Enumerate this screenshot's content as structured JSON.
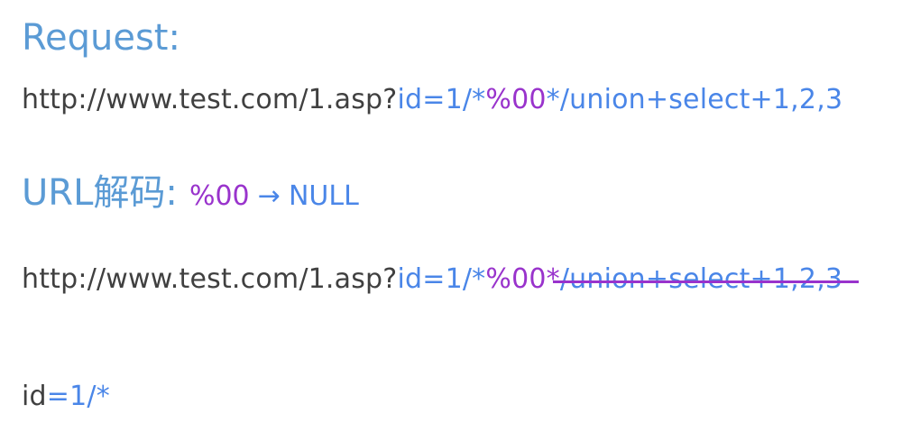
{
  "request": {
    "heading": "Request:",
    "url_base": "http://www.test.com/1.asp?",
    "param_name": "id",
    "equals": "=",
    "value_prefix": "1/*",
    "null_byte": "%00",
    "comment_close": "*/",
    "payload": "union+select+1,2,3"
  },
  "decode": {
    "heading": "URL解码:",
    "null_byte": "%00",
    "arrow": "→",
    "result": "NULL"
  },
  "decoded": {
    "url_base": "http://www.test.com/1.asp?",
    "param_name": "id",
    "equals": "=",
    "value_prefix": "1/*",
    "null_byte": "%00",
    "comment_close": "*",
    "struck_text": "/union+select+1,2,3"
  },
  "result": {
    "param_name": "id",
    "equals": "=",
    "value": "1/*"
  },
  "colors": {
    "heading": "#5b9bd5",
    "text": "#404040",
    "param": "#4a86e8",
    "null_byte": "#9933cc"
  }
}
